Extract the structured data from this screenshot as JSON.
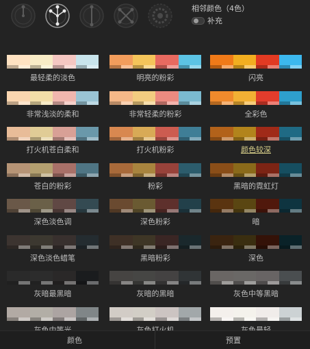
{
  "header": {
    "rule_title": "相邻颜色（4色）",
    "toggle_label": "补充",
    "mode_icons": [
      "color-wheel-dial-icon",
      "color-wheel-triad-icon",
      "color-wheel-pair-icon",
      "color-wheel-cross-icon",
      "color-wheel-gear-icon"
    ],
    "active_mode_index": 1
  },
  "palettes": [
    {
      "label": "最轻柔的淡色",
      "colors": [
        "#ffe2c2",
        "#f8ecc6",
        "#f5c7c2",
        "#c8e4ec"
      ]
    },
    {
      "label": "明亮的粉彩",
      "colors": [
        "#f29d5c",
        "#f4c45a",
        "#e86a60",
        "#5cc3e4"
      ]
    },
    {
      "label": "闪亮",
      "colors": [
        "#f07a18",
        "#f2ae20",
        "#e23a22",
        "#3cb8ee"
      ]
    },
    {
      "label": "非常浅淡的柔和",
      "colors": [
        "#fbd6b0",
        "#f2dea8",
        "#f0b6ae",
        "#9ac4d4"
      ]
    },
    {
      "label": "非常轻柔的粉彩",
      "colors": [
        "#f5b888",
        "#f2cc80",
        "#ec8a80",
        "#7bbad0"
      ]
    },
    {
      "label": "全彩色",
      "colors": [
        "#f08a2c",
        "#f2b034",
        "#e23c2c",
        "#2e9fcc"
      ]
    },
    {
      "label": "打火机苍白柔和",
      "colors": [
        "#e8bc98",
        "#e0cc96",
        "#d8a096",
        "#6a98aa"
      ]
    },
    {
      "label": "打火机粉彩",
      "colors": [
        "#d88850",
        "#d8aa56",
        "#cc5c50",
        "#3f7e96"
      ]
    },
    {
      "label": "颜色较深",
      "colors": [
        "#b2621a",
        "#b2841c",
        "#a02a18",
        "#1f6a84"
      ]
    },
    {
      "label": "苍白的粉彩",
      "colors": [
        "#b69476",
        "#b4a070",
        "#a87068",
        "#4f7584"
      ]
    },
    {
      "label": "粉彩",
      "colors": [
        "#a86a3a",
        "#a8843e",
        "#98423a",
        "#2c5c6c"
      ]
    },
    {
      "label": "黑暗的霓虹灯",
      "colors": [
        "#8a4e18",
        "#8a6a1a",
        "#7c2414",
        "#164e60"
      ]
    },
    {
      "label": "深色淡色调",
      "colors": [
        "#6a5848",
        "#6a6048",
        "#604844",
        "#344a52"
      ]
    },
    {
      "label": "深色粉彩",
      "colors": [
        "#6a4a30",
        "#6a5a32",
        "#5e302c",
        "#22404a"
      ]
    },
    {
      "label": "暗",
      "colors": [
        "#5a3410",
        "#5a4612",
        "#50180c",
        "#0e3440"
      ]
    },
    {
      "label": "深色淡色蜡笔",
      "colors": [
        "#3c3430",
        "#3c3830",
        "#38302e",
        "#242c30"
      ]
    },
    {
      "label": "黑暗粉彩",
      "colors": [
        "#3e3026",
        "#3e3626",
        "#3a2624",
        "#1a282c"
      ]
    },
    {
      "label": "深色",
      "colors": [
        "#3a2410",
        "#3a2e10",
        "#341208",
        "#0a2228"
      ]
    },
    {
      "label": "灰暗最黑暗",
      "colors": [
        "#2a2a2a",
        "#2c2c2c",
        "#2a2828",
        "#1a1c1e"
      ]
    },
    {
      "label": "灰暗的黑暗",
      "colors": [
        "#464442",
        "#464644",
        "#444242",
        "#303436"
      ]
    },
    {
      "label": "灰色中等黑暗",
      "colors": [
        "#6a6664",
        "#6a6866",
        "#686464",
        "#4a4e50"
      ]
    },
    {
      "label": "灰色中等光",
      "colors": [
        "#b2aaa4",
        "#b2aea6",
        "#aca4a2",
        "#808688"
      ]
    },
    {
      "label": "灰色打火机",
      "colors": [
        "#d2ccc6",
        "#d2cec6",
        "#ccc4c2",
        "#a2a8aa"
      ]
    },
    {
      "label": "灰色最轻",
      "colors": [
        "#f4f0ec",
        "#f4f2ec",
        "#f0ecea",
        "#ccd2d4"
      ]
    }
  ],
  "selected_palette": "颜色较深",
  "footer": {
    "tabs": [
      "颜色",
      "预置"
    ]
  }
}
